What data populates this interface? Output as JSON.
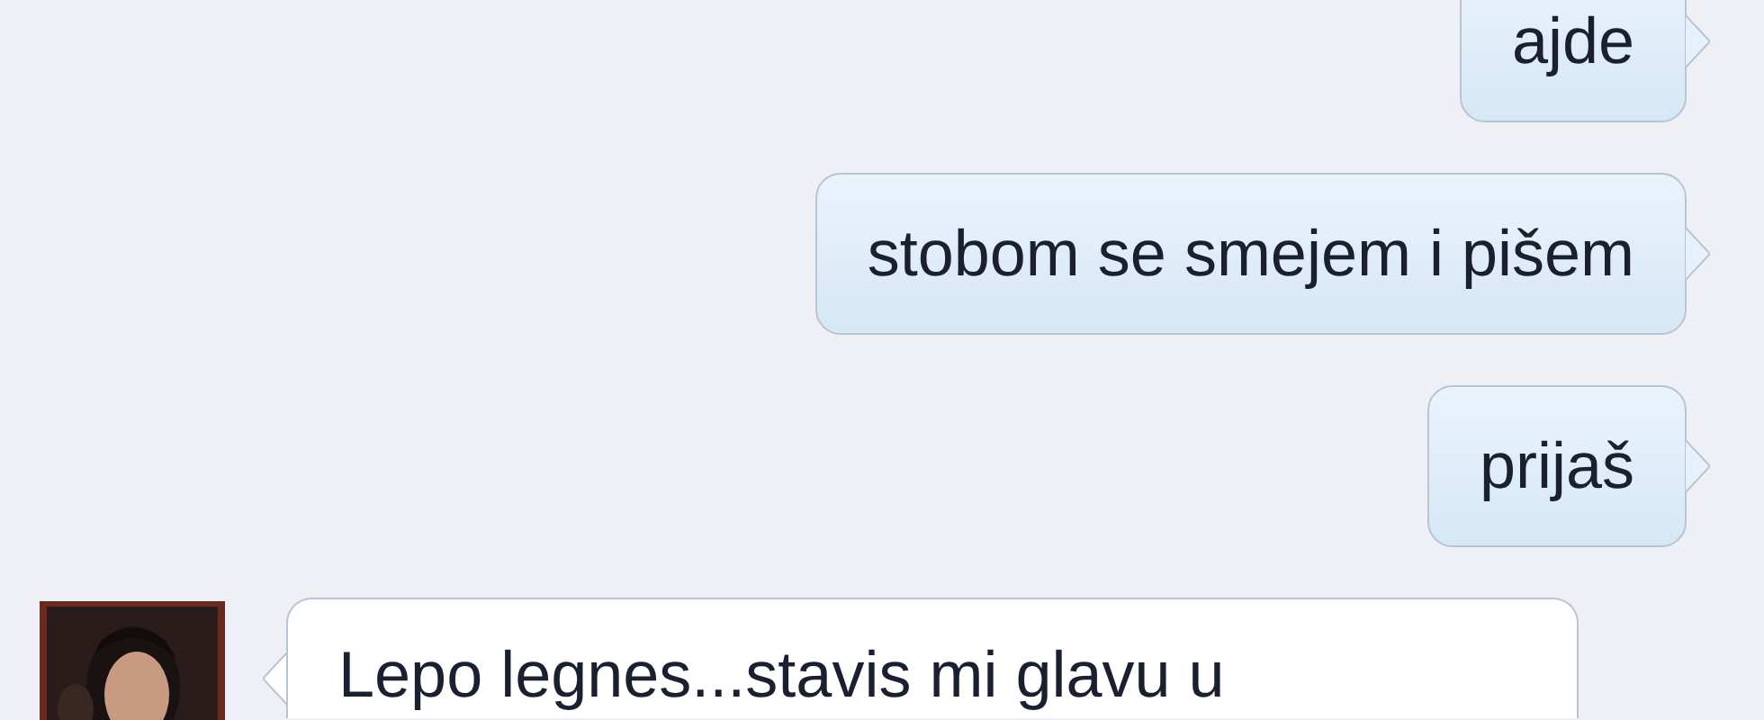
{
  "messages": [
    {
      "kind": "outgoing",
      "text": "ajde"
    },
    {
      "kind": "outgoing",
      "text": "stobom se smejem i pišem"
    },
    {
      "kind": "outgoing",
      "text": "prijaš"
    },
    {
      "kind": "incoming",
      "text": "Lepo legnes...stavis mi glavu u"
    }
  ]
}
